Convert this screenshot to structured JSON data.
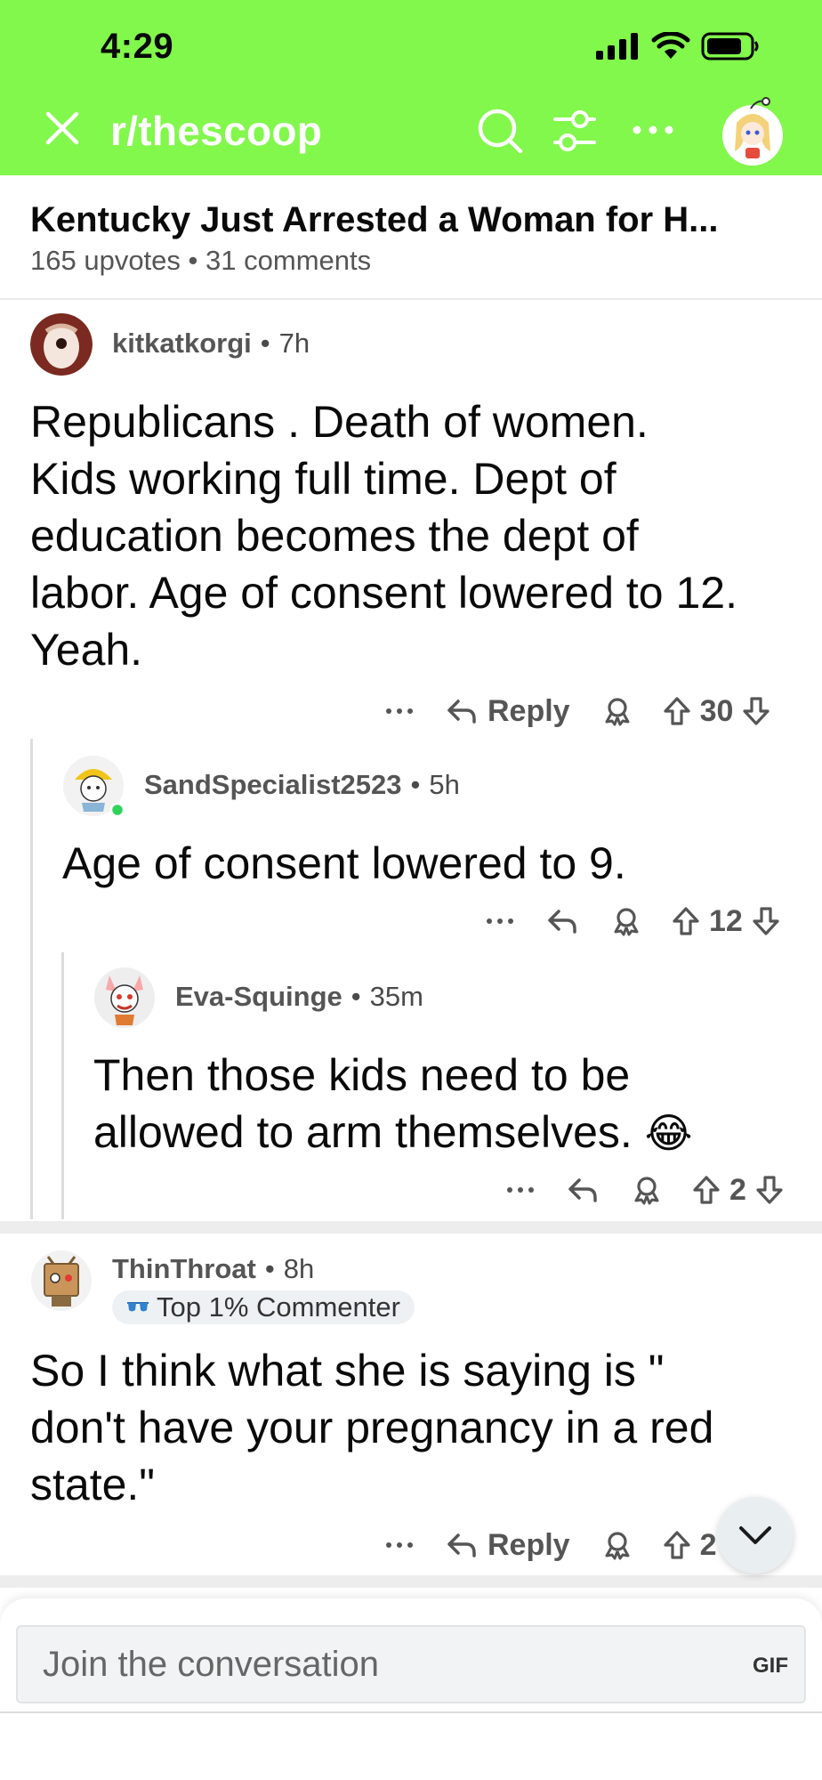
{
  "colors": {
    "accent": "#82f74c",
    "online": "#2fd35a",
    "text": "#0a0a0a",
    "muted": "#555555"
  },
  "status_bar": {
    "time": "4:29"
  },
  "nav": {
    "subreddit": "r/thescoop"
  },
  "post": {
    "title": "Kentucky Just Arrested a Woman for H...",
    "upvotes": "165 upvotes",
    "comments": "31 comments",
    "meta_dot": "•"
  },
  "comments": [
    {
      "user": "kitkatkorgi",
      "age": "7h",
      "lines": [
        "Republicans . Death of women.",
        "Kids working full time. Dept of",
        "education becomes the dept of",
        "labor. Age of consent lowered to 12.",
        "Yeah."
      ],
      "reply_label": "Reply",
      "votes": "30"
    },
    {
      "user": "SandSpecialist2523",
      "age": "5h",
      "lines": [
        "Age of consent lowered to 9."
      ],
      "votes": "12"
    },
    {
      "user": "Eva-Squinge",
      "age": "35m",
      "lines": [
        "Then those kids need to be",
        "allowed to arm themselves."
      ],
      "emoji": "😂",
      "votes": "2"
    },
    {
      "user": "ThinThroat",
      "age": "8h",
      "badge": "Top 1% Commenter",
      "lines": [
        "So I think what she is saying is \"",
        "don't have your pregnancy in a red",
        "state.\""
      ],
      "reply_label": "Reply",
      "votes": "2"
    }
  ],
  "composer": {
    "placeholder": "Join the conversation",
    "gif_label": "GIF"
  },
  "icons": [
    "close-icon",
    "search-icon",
    "filter-icon",
    "more-icon",
    "reply-icon",
    "award-icon",
    "upvote-icon",
    "downvote-icon",
    "chevron-down-icon",
    "signal-icon",
    "wifi-icon",
    "battery-icon"
  ]
}
